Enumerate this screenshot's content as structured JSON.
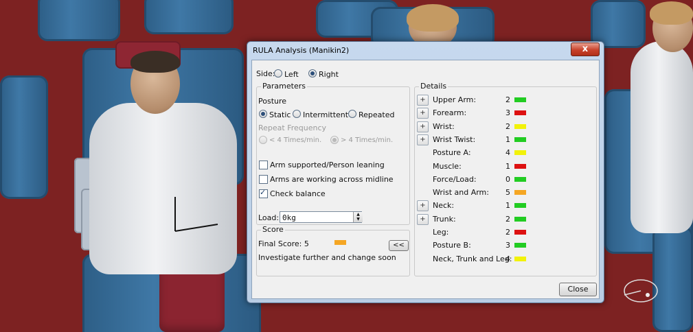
{
  "window": {
    "title": "RULA Analysis (Manikin2)",
    "close_glyph": "x"
  },
  "side": {
    "label": "Side:",
    "options": [
      "Left",
      "Right"
    ],
    "selected": "Right"
  },
  "parameters": {
    "legend": "Parameters",
    "posture_label": "Posture",
    "posture_options": [
      "Static",
      "Intermittent",
      "Repeated"
    ],
    "posture_selected": "Static",
    "repeat_frequency_label": "Repeat Frequency",
    "frequency_options": [
      "< 4 Times/min.",
      "> 4 Times/min."
    ],
    "frequency_selected": "> 4 Times/min.",
    "checkboxes": [
      {
        "label": "Arm supported/Person leaning",
        "checked": false
      },
      {
        "label": "Arms are working across midline",
        "checked": false
      },
      {
        "label": "Check balance",
        "checked": true
      }
    ],
    "load_label": "Load:",
    "load_value": "0kg"
  },
  "score": {
    "legend": "Score",
    "final_label": "Final Score: 5",
    "final_color": "#f5a623",
    "collapse_label": "<<",
    "advice": "Investigate further and change soon"
  },
  "details": {
    "legend": "Details",
    "rows": [
      {
        "label": "Upper Arm:",
        "value": "2",
        "color": "#22cc22",
        "expandable": true
      },
      {
        "label": "Forearm:",
        "value": "3",
        "color": "#dd1111",
        "expandable": true
      },
      {
        "label": "Wrist:",
        "value": "2",
        "color": "#f2f20a",
        "expandable": true
      },
      {
        "label": "Wrist Twist:",
        "value": "1",
        "color": "#22cc22",
        "expandable": true
      },
      {
        "label": "Posture A:",
        "value": "4",
        "color": "#f2f20a",
        "expandable": false
      },
      {
        "label": "Muscle:",
        "value": "1",
        "color": "#dd1111",
        "expandable": false
      },
      {
        "label": "Force/Load:",
        "value": "0",
        "color": "#22cc22",
        "expandable": false
      },
      {
        "label": "Wrist and Arm:",
        "value": "5",
        "color": "#f5a623",
        "expandable": false
      },
      {
        "label": "Neck:",
        "value": "1",
        "color": "#22cc22",
        "expandable": true
      },
      {
        "label": "Trunk:",
        "value": "2",
        "color": "#22cc22",
        "expandable": true
      },
      {
        "label": "Leg:",
        "value": "2",
        "color": "#dd1111",
        "expandable": false
      },
      {
        "label": "Posture B:",
        "value": "3",
        "color": "#22cc22",
        "expandable": false
      },
      {
        "label": "Neck, Trunk and Leg:",
        "value": "4",
        "color": "#f2f20a",
        "expandable": false
      }
    ],
    "expand_glyph": "+"
  },
  "footer": {
    "close_label": "Close"
  }
}
